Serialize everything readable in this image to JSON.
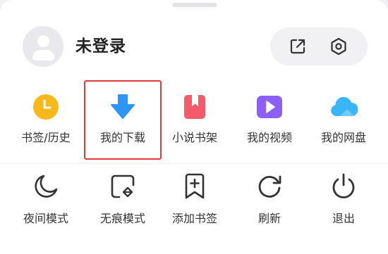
{
  "account": {
    "username": "未登录",
    "share_icon": "share-out-icon",
    "settings_icon": "settings-icon"
  },
  "grid_row1": [
    {
      "label": "书签/历史",
      "icon": "clock-icon",
      "color": "#f7b81b"
    },
    {
      "label": "我的下载",
      "icon": "download-arrow-icon",
      "color": "#2f95f5"
    },
    {
      "label": "小说书架",
      "icon": "bookmark-book-icon",
      "color": "#f35b6b"
    },
    {
      "label": "我的视频",
      "icon": "video-play-icon",
      "color": "#8c60f5"
    },
    {
      "label": "我的网盘",
      "icon": "cloud-icon",
      "color": "#3ab5f5"
    }
  ],
  "grid_row2": [
    {
      "label": "夜间模式",
      "icon": "moon-icon"
    },
    {
      "label": "无痕模式",
      "icon": "incognito-icon"
    },
    {
      "label": "添加书签",
      "icon": "add-bookmark-icon"
    },
    {
      "label": "刷新",
      "icon": "refresh-icon"
    },
    {
      "label": "退出",
      "icon": "power-icon"
    }
  ],
  "highlight_color": "#e63939"
}
